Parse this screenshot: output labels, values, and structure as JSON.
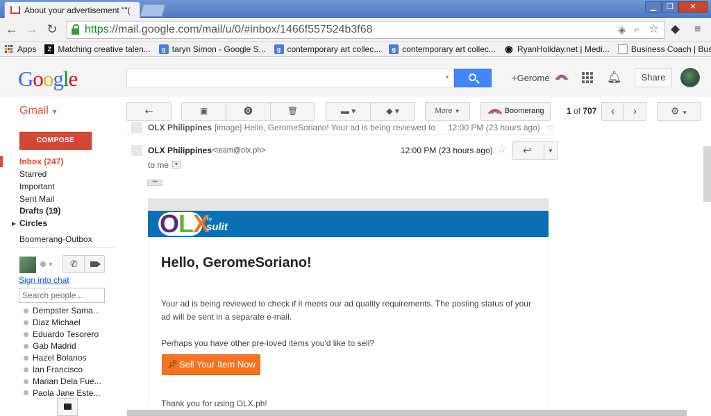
{
  "browser": {
    "tab_title": "About your advertisement \"\"(",
    "url_https": "https",
    "url_rest": "://mail.google.com/mail/u/0/#inbox/1466f557524b3f68"
  },
  "bookmarks": [
    {
      "label": "Apps"
    },
    {
      "label": "Matching creative talen..."
    },
    {
      "label": "taryn Simon - Google S..."
    },
    {
      "label": "contemporary art collec..."
    },
    {
      "label": "contemporary art collec..."
    },
    {
      "label": "RyanHoliday.net | Medi..."
    },
    {
      "label": "Business Coach | Busin..."
    }
  ],
  "bookmarks_overflow": "»",
  "google": {
    "logo": [
      "G",
      "o",
      "o",
      "g",
      "l",
      "e"
    ],
    "logo_colors": [
      "#3369e8",
      "#d50f25",
      "#eeb211",
      "#3369e8",
      "#009925",
      "#d50f25"
    ],
    "plus_user": "+Gerome",
    "share_label": "Share"
  },
  "gmail": {
    "label": "Gmail",
    "more_label": "More",
    "boomerang_label": "Boomerang",
    "count_current": "1",
    "count_of": "of",
    "count_total": "707"
  },
  "nav": {
    "compose": "COMPOSE",
    "items": [
      {
        "label": "Inbox (247)"
      },
      {
        "label": "Starred"
      },
      {
        "label": "Important"
      },
      {
        "label": "Sent Mail"
      },
      {
        "label": "Drafts (19)"
      },
      {
        "label": "Circles"
      },
      {
        "label": "Boomerang-Outbox"
      }
    ],
    "inbox_color": "#dd4b39"
  },
  "chat": {
    "signin": "Sign into chat",
    "search_placeholder": "Search people...",
    "contacts": [
      {
        "name": "Dempster Sama..."
      },
      {
        "name": "Diaz Michael"
      },
      {
        "name": "Eduardo Tesorero"
      },
      {
        "name": "Gab Madrid"
      },
      {
        "name": "Hazel Bolanos"
      },
      {
        "name": "Ian Francisco"
      },
      {
        "name": "Marian Dela Fue..."
      },
      {
        "name": "Paola Jane Este..."
      }
    ]
  },
  "collapsed_message": {
    "sender": "OLX Philippines",
    "snippet": "[image] Hello, GeromeSoriano! Your ad is being reviewed to",
    "time": "12:00 PM (23 hours ago)"
  },
  "message": {
    "sender": "OLX Philippines",
    "email": "<team@olx.ph>",
    "time": "12:00 PM (23 hours ago)",
    "to": "to me",
    "ellipsis": "•••"
  },
  "email_body": {
    "logo_o": "O",
    "logo_l": "L",
    "logo_x": "X",
    "by": "by",
    "sulit": "sulit",
    "greeting": "Hello, GeromeSoriano!",
    "para1": "Your ad is being reviewed to check if it meets our ad quality requirements. The posting status of your ad will be sent in a separate e-mail.",
    "para2": "Perhaps you have other pre-loved items you'd like to sell?",
    "sell_button": "Sell Your Item Now",
    "thanks": "Thank you for using OLX.ph!"
  }
}
